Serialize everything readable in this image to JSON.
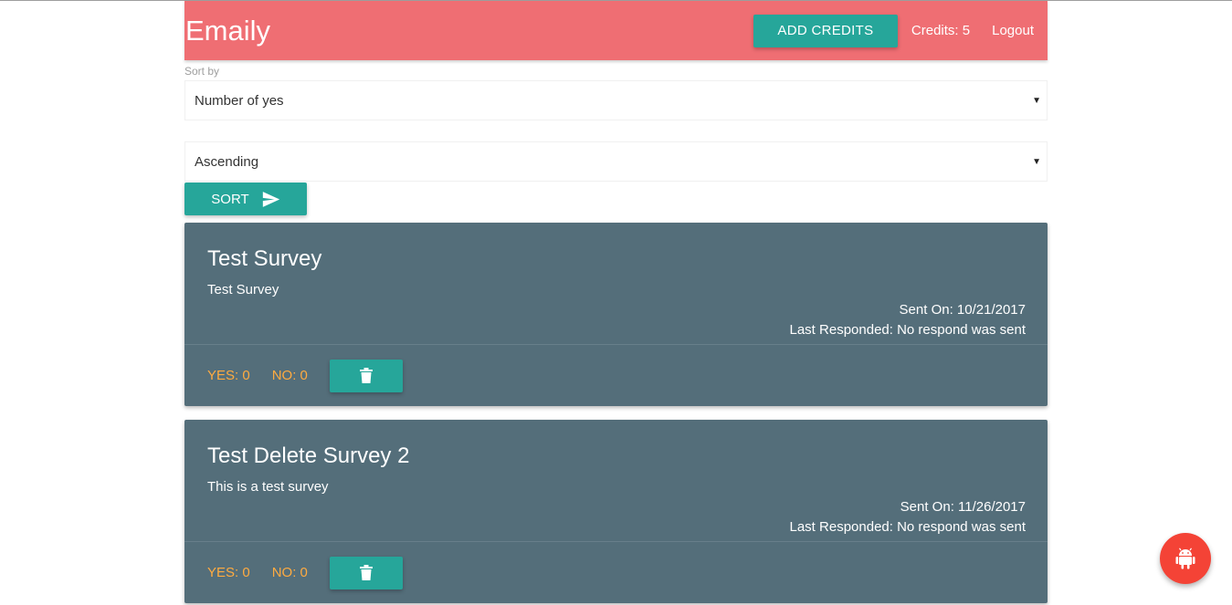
{
  "navbar": {
    "brand": "Emaily",
    "add_credits_label": "ADD CREDITS",
    "credits_text": "Credits: 5",
    "logout_label": "Logout",
    "color": "#ef6e73"
  },
  "sort": {
    "label": "Sort by",
    "field_selected": "Number of yes",
    "order_selected": "Ascending",
    "button_label": "SORT",
    "button_icon": "send-icon"
  },
  "surveys": [
    {
      "title": "Test Survey",
      "body": "Test Survey",
      "sent_on": "Sent On: 10/21/2017",
      "last_responded": "Last Responded: No respond was sent",
      "yes": "YES: 0",
      "no": "NO: 0",
      "delete_icon": "trash-icon"
    },
    {
      "title": "Test Delete Survey 2",
      "body": "This is a test survey",
      "sent_on": "Sent On: 11/26/2017",
      "last_responded": "Last Responded: No respond was sent",
      "yes": "YES: 0",
      "no": "NO: 0",
      "delete_icon": "trash-icon"
    }
  ],
  "fab": {
    "icon": "android-icon",
    "color": "#f44336"
  },
  "colors": {
    "accent": "#26a69a",
    "card": "#546e7a",
    "count": "#ffab40"
  }
}
